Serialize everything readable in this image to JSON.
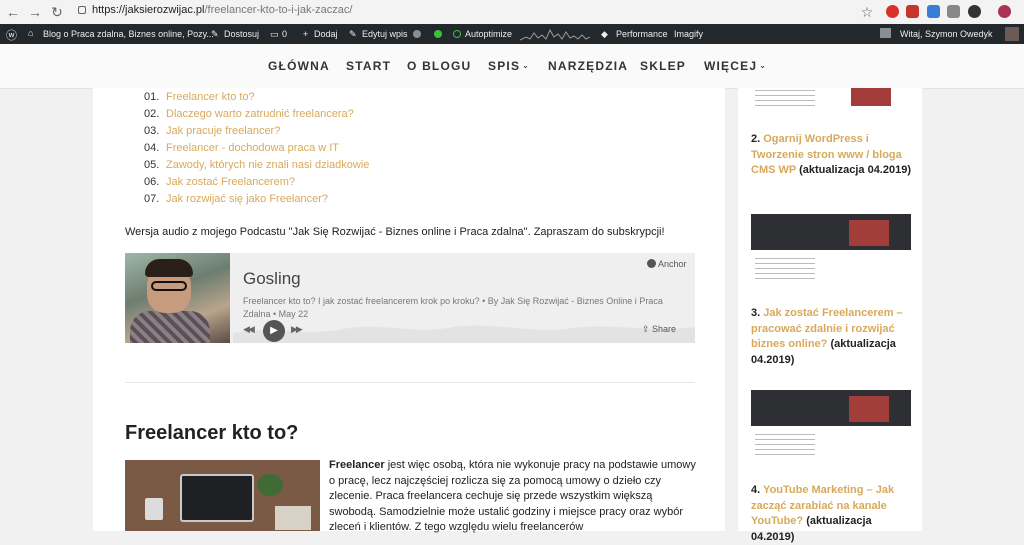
{
  "browser": {
    "url_domain": "https://jaksierozwijac.pl",
    "url_path": "/freelancer-kto-to-i-jak-zaczac/"
  },
  "adminbar": {
    "site_title": "Blog o Praca zdalna, Biznes online, Pozy...",
    "customize": "Dostosuj",
    "comments_count": "0",
    "add_new": "Dodaj",
    "edit_post": "Edytuj wpis",
    "autoptimize": "Autoptimize",
    "performance": "Performance",
    "imagify": "Imagify",
    "greeting": "Witaj, Szymon Owedyk"
  },
  "nav": {
    "items": [
      "GŁÓWNA",
      "START",
      "O BLOGU",
      "SPIS",
      "NARZĘDZIA",
      "SKLEP",
      "WIĘCEJ"
    ]
  },
  "toc": [
    {
      "num": "01.",
      "label": "Freelancer kto to?"
    },
    {
      "num": "02.",
      "label": "Dlaczego warto zatrudnić freelancera?"
    },
    {
      "num": "03.",
      "label": "Jak pracuje freelancer?"
    },
    {
      "num": "04.",
      "label": "Freelancer - dochodowa praca w IT"
    },
    {
      "num": "05.",
      "label": "Zawody, których nie znali nasi dziadkowie"
    },
    {
      "num": "06.",
      "label": "Jak zostać Freelancerem?"
    },
    {
      "num": "07.",
      "label": "Jak rozwijać się jako Freelancer?"
    }
  ],
  "audio_intro": "Wersja audio z mojego Podcastu \"Jak Się Rozwijać - Biznes online i Praca zdalna\". Zapraszam do subskrypcji!",
  "player": {
    "brand": "Anchor",
    "title": "Gosling",
    "description": "Freelancer kto to? I jak zostać freelancerem krok po kroku? • By Jak Się Rozwijać - Biznes Online i Praca Zdalna • May 22",
    "share": "Share"
  },
  "section": {
    "heading": "Freelancer kto to?",
    "paragraph_bold": "Freelancer",
    "paragraph_rest": " jest więc osobą, która nie wykonuje pracy na podstawie umowy o pracę, lecz najczęściej rozlicza się za pomocą umowy o dzieło czy zlecenie. Praca freelancera cechuje się przede wszystkim większą swobodą. Samodzielnie może ustalić godziny i miejsce pracy oraz wybór zleceń i klientów. Z tego względu wielu freelancerów"
  },
  "sidebar": {
    "items": [
      {
        "num": "2.",
        "link": "Ogarnij WordPress i Tworzenie stron www / bloga CMS WP",
        "suffix": "(aktualizacja 04.2019)"
      },
      {
        "num": "3.",
        "link": "Jak zostać Freelancerem – pracować zdalnie i rozwijać biznes online?",
        "suffix": "(aktualizacja 04.2019)"
      },
      {
        "num": "4.",
        "link": "YouTube Marketing – Jak zacząć zarabiać na kanale YouTube?",
        "suffix": "(aktualizacja 04.2019)"
      }
    ]
  },
  "colors": {
    "link": "#d8a95a",
    "adminbar": "#23282d"
  }
}
